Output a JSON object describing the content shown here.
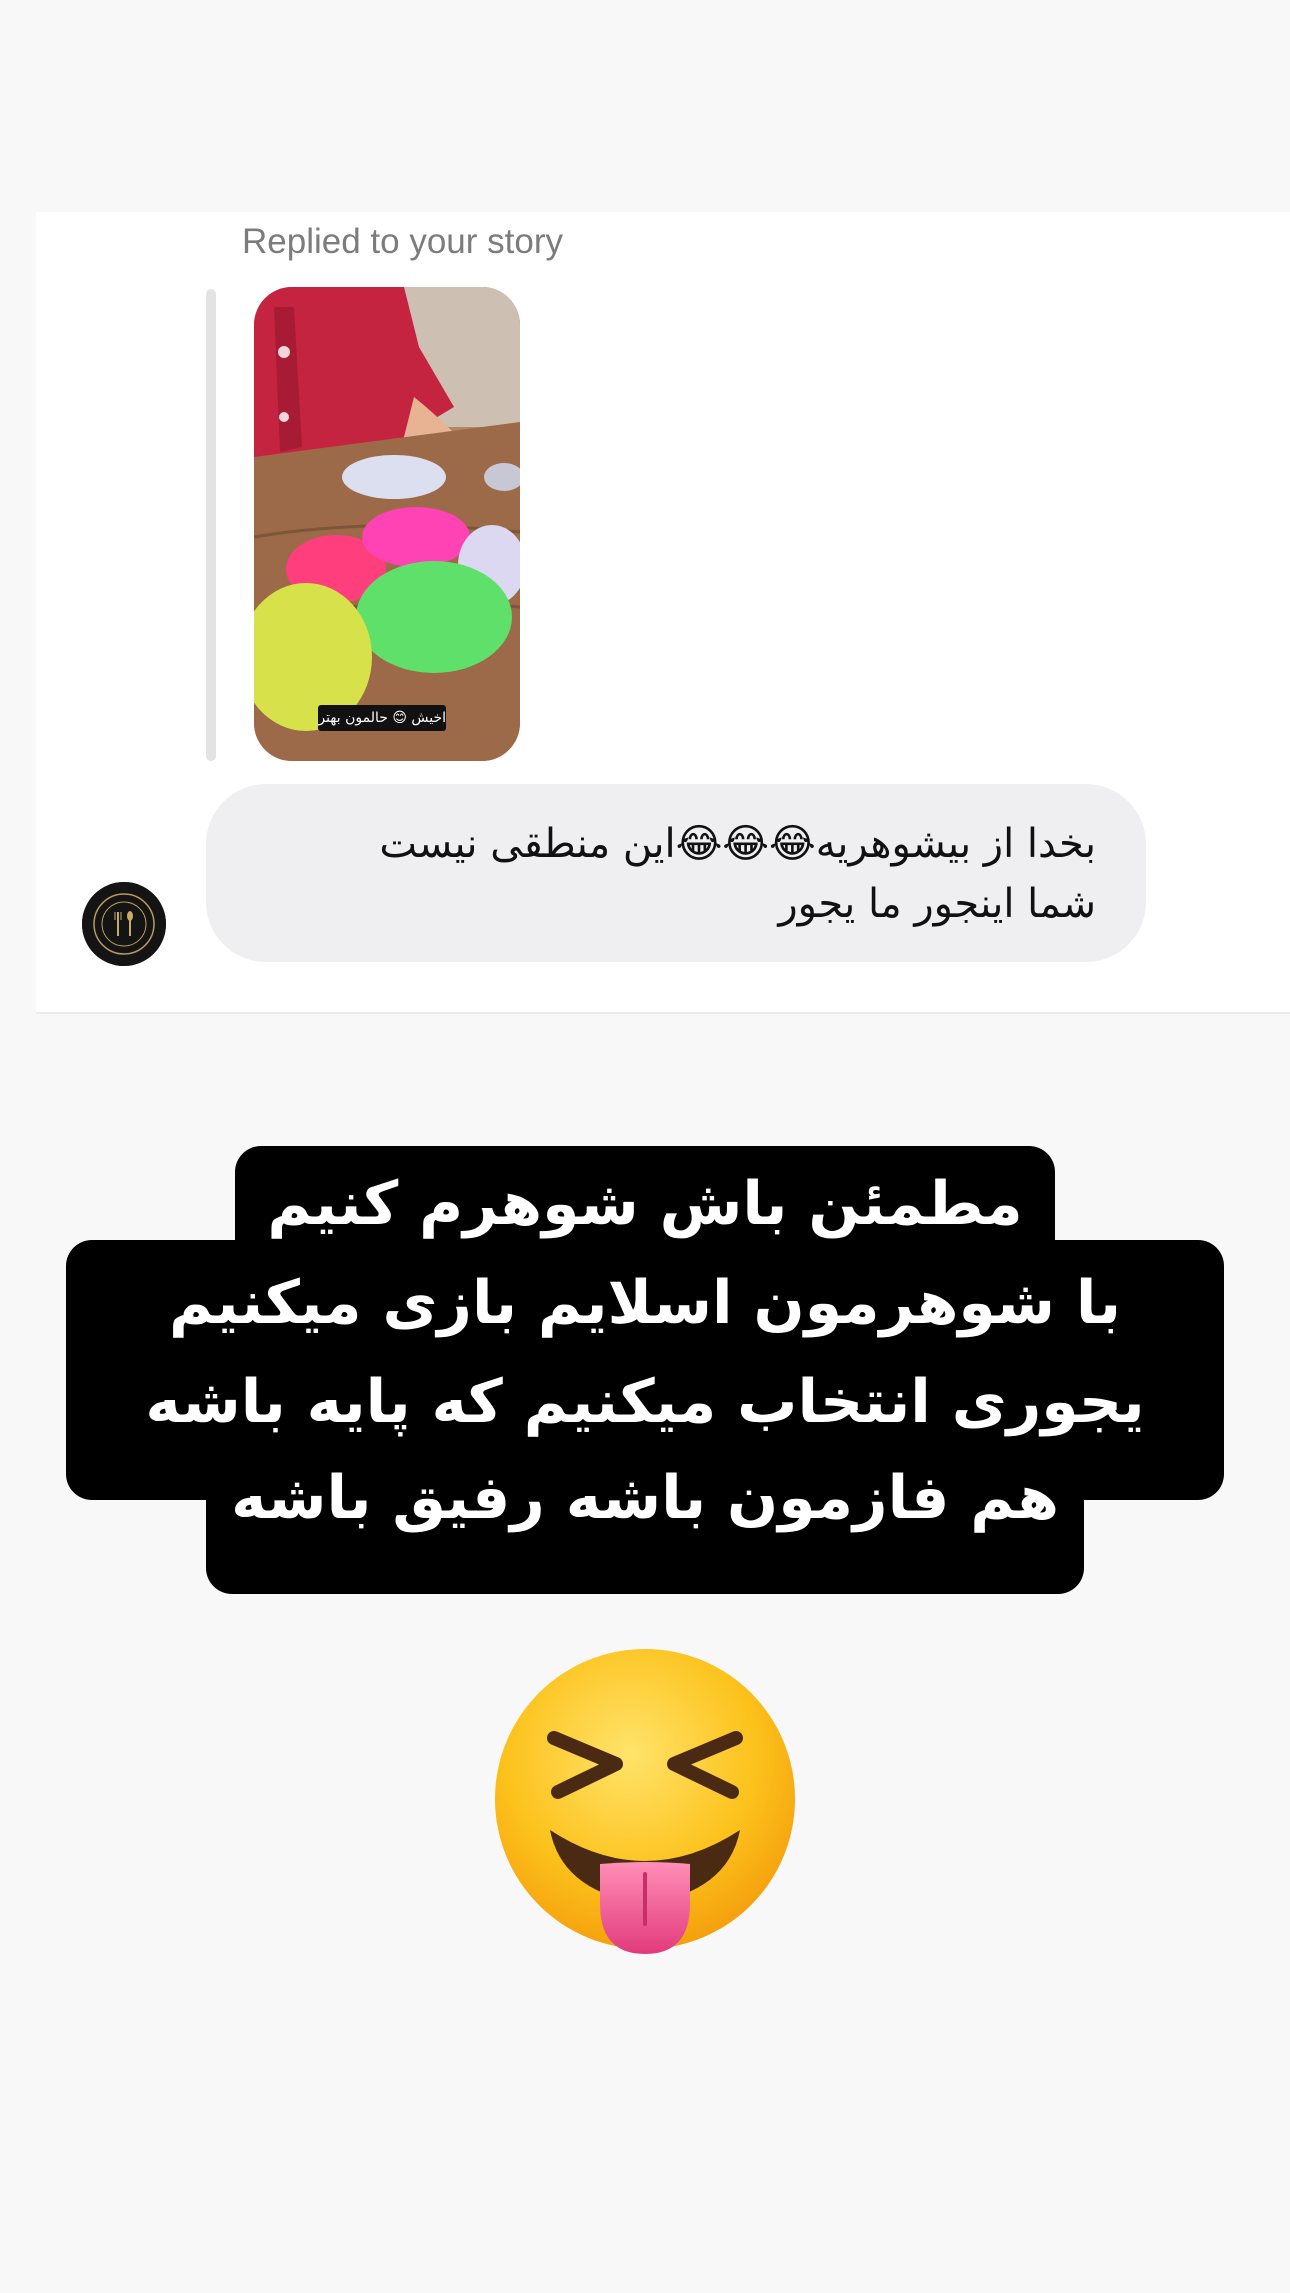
{
  "dm": {
    "reply_label": "Replied to your story",
    "story_caption": "اخیش 😊 حالمون بهتر شد",
    "message_lines": [
      "بخدا از بیشوهریه😂😂😂این منطقی نیست",
      "شما اینجور ما یجور"
    ]
  },
  "story_text": {
    "lines": [
      "مطمئن باش شوهرم کنیم",
      "با شوهرمون اسلایم بازی میکنیم",
      "یجوری انتخاب میکنیم که پایه باشه",
      "هم فازمون باشه رفیق باشه"
    ],
    "background_color": "#000000",
    "text_color": "#ffffff"
  },
  "sticker_emoji": "squinting-face-with-tongue",
  "colors": {
    "page_background": "#f8f8f8",
    "card_background": "#ffffff",
    "bubble_background": "#efeff1",
    "label_gray": "#7c7c7c"
  }
}
